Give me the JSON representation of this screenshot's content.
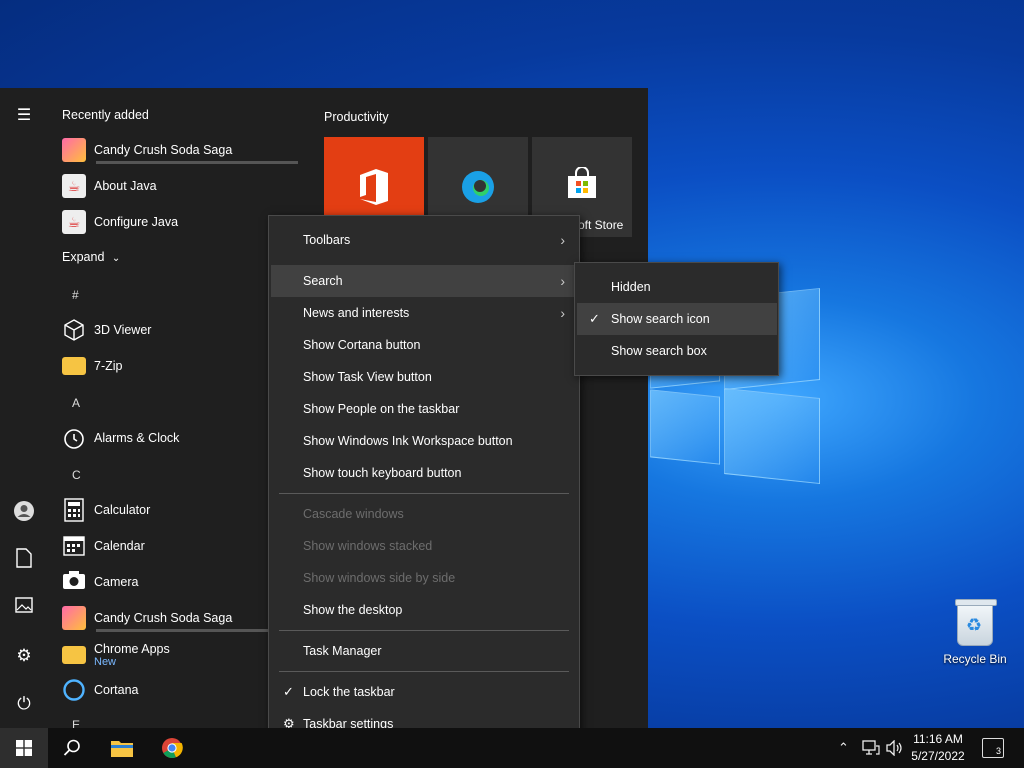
{
  "start_menu": {
    "recently_added_header": "Recently added",
    "recent": [
      {
        "label": "Candy Crush Soda Saga",
        "icon": "candy-icon"
      },
      {
        "label": "About Java",
        "icon": "java-icon"
      },
      {
        "label": "Configure Java",
        "icon": "java-icon"
      }
    ],
    "expand_label": "Expand",
    "letters": [
      "#",
      "A",
      "C",
      "E"
    ],
    "apps": [
      {
        "label": "3D Viewer"
      },
      {
        "label": "7-Zip"
      },
      {
        "label": "Alarms & Clock"
      },
      {
        "label": "Calculator"
      },
      {
        "label": "Calendar"
      },
      {
        "label": "Camera"
      },
      {
        "label": "Candy Crush Soda Saga"
      },
      {
        "label": "Chrome Apps",
        "sublabel": "New"
      },
      {
        "label": "Cortana"
      }
    ],
    "tiles_header": "Productivity",
    "tile_label": "oft Store"
  },
  "context_menu": {
    "items": [
      {
        "label": "Toolbars",
        "submenu": true
      },
      {
        "label": "Search",
        "submenu": true,
        "highlighted": true
      },
      {
        "label": "News and interests",
        "submenu": true
      },
      {
        "label": "Show Cortana button"
      },
      {
        "label": "Show Task View button"
      },
      {
        "label": "Show People on the taskbar"
      },
      {
        "label": "Show Windows Ink Workspace button"
      },
      {
        "label": "Show touch keyboard button"
      },
      {
        "label": "Cascade windows",
        "disabled": true
      },
      {
        "label": "Show windows stacked",
        "disabled": true
      },
      {
        "label": "Show windows side by side",
        "disabled": true
      },
      {
        "label": "Show the desktop"
      },
      {
        "label": "Task Manager"
      },
      {
        "label": "Lock the taskbar",
        "checked": true
      },
      {
        "label": "Taskbar settings",
        "icon": "gear-icon"
      }
    ]
  },
  "search_submenu": {
    "items": [
      {
        "label": "Hidden"
      },
      {
        "label": "Show search icon",
        "checked": true,
        "highlighted": true
      },
      {
        "label": "Show search box"
      }
    ]
  },
  "desktop": {
    "recycle_bin_label": "Recycle Bin"
  },
  "taskbar": {
    "time": "11:16 AM",
    "date": "5/27/2022",
    "notification_count": "3"
  },
  "colors": {
    "office_tile": "#e33e13",
    "menu_bg": "#2b2b2b",
    "start_bg": "#1f1f1f"
  }
}
